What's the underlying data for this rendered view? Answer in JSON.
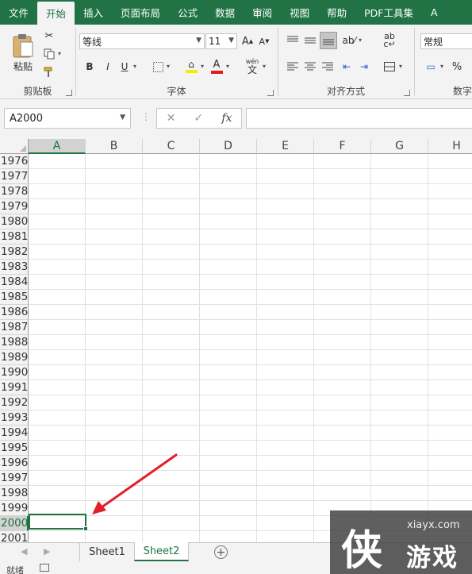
{
  "menu_tabs": [
    "文件",
    "开始",
    "插入",
    "页面布局",
    "公式",
    "数据",
    "审阅",
    "视图",
    "帮助",
    "PDF工具集",
    "A"
  ],
  "ribbon": {
    "clipboard": {
      "paste_label": "粘贴",
      "group_label": "剪贴板"
    },
    "font": {
      "font_name": "等线",
      "font_size": "11",
      "group_label": "字体",
      "bold": "B",
      "italic": "I",
      "underline": "U",
      "font_color_letter": "A",
      "wen": "wén",
      "wen_char": "文",
      "font_color": "#e01b1b",
      "highlight_color": "#ffe800"
    },
    "alignment": {
      "group_label": "对齐方式"
    },
    "number": {
      "format": "常规",
      "group_label": "数字",
      "percent": "%"
    }
  },
  "formula_bar": {
    "name_box": "A2000",
    "fx": "fx",
    "cancel": "✕",
    "enter": "✓",
    "dots": "⋮"
  },
  "columns": [
    "A",
    "B",
    "C",
    "D",
    "E",
    "F",
    "G",
    "H"
  ],
  "rows": [
    "1976",
    "1977",
    "1978",
    "1979",
    "1980",
    "1981",
    "1982",
    "1983",
    "1984",
    "1985",
    "1986",
    "1987",
    "1988",
    "1989",
    "1990",
    "1991",
    "1992",
    "1993",
    "1994",
    "1995",
    "1996",
    "1997",
    "1998",
    "1999",
    "2000",
    "2001"
  ],
  "selected_row": "2000",
  "selected_col": "A",
  "sheets": [
    "Sheet1",
    "Sheet2"
  ],
  "active_sheet": "Sheet2",
  "status": {
    "ready": "就绪"
  },
  "watermark": {
    "url": "xiayx.com",
    "logo_char": "侠",
    "text": "游戏"
  },
  "colors": {
    "excel_green": "#217346",
    "arrow_red": "#e0202a"
  }
}
